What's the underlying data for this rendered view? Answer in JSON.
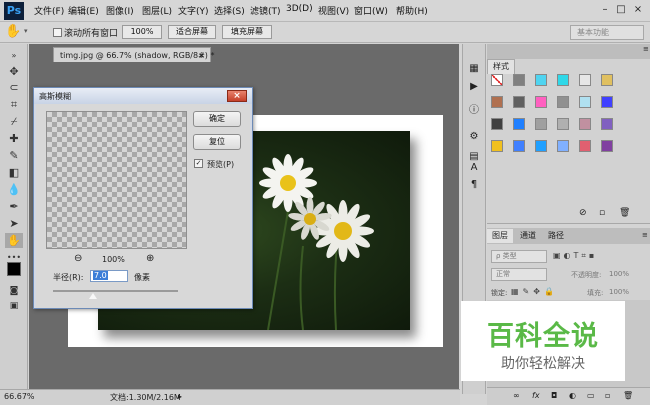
{
  "app": {
    "logo": "Ps"
  },
  "menubar": {
    "items": [
      "文件(F)",
      "编辑(E)",
      "图像(I)",
      "图层(L)",
      "文字(Y)",
      "选择(S)",
      "滤镜(T)",
      "3D(D)",
      "视图(V)",
      "窗口(W)",
      "帮助(H)"
    ]
  },
  "optionsbar": {
    "scroll_all_label": "滚动所有窗口",
    "zoom_100": "100%",
    "fit_screen": "适合屏幕",
    "fill_screen": "填充屏幕",
    "workspace": "基本功能"
  },
  "document": {
    "tab_title": "timg.jpg @ 66.7% (shadow, RGB/8#) *",
    "close_glyph": "×"
  },
  "statusbar": {
    "zoom": "66.67%",
    "doc_info": "文档:1.30M/2.16M"
  },
  "dialog": {
    "title": "高斯模糊",
    "close_glyph": "×",
    "ok_label": "确定",
    "reset_label": "复位",
    "preview_label": "预览(P)",
    "preview_checked": true,
    "zoom_level": "100%",
    "radius_label": "半径(R):",
    "radius_value": "7.0",
    "unit_label": "像素"
  },
  "swatches_panel": {
    "tab_label": "样式",
    "swatch_colors": [
      "#ffffff",
      "#808080",
      "#4fd4f0",
      "#2fd8e8",
      "#e6e6e6",
      "#e0c060",
      "#b07050",
      "#606060",
      "#ff60c0",
      "#909090",
      "#b0e0f0",
      "#4040ff",
      "#404040",
      "#2080ff",
      "#a0a0a0",
      "#b0b0b0",
      "#c090a0",
      "#8060c0",
      "#f0c020",
      "#4080ff",
      "#20a0ff",
      "#80b0ff",
      "#e06070",
      "#8040a0"
    ]
  },
  "layers_panel": {
    "tabs": [
      "图层",
      "通道",
      "路径"
    ],
    "kind_label": "ρ 类型",
    "blend_mode": "正常",
    "opacity_label": "不透明度:",
    "opacity_value": "100%",
    "lock_label": "锁定:",
    "fill_label": "填充:",
    "fill_value": "100%",
    "bottom_icons": [
      "link-icon",
      "fx-icon",
      "mask-icon",
      "adjustment-icon",
      "group-icon",
      "new-layer-icon",
      "delete-icon"
    ]
  },
  "watermark": {
    "title": "百科全说",
    "subtitle": "助你轻松解决"
  }
}
